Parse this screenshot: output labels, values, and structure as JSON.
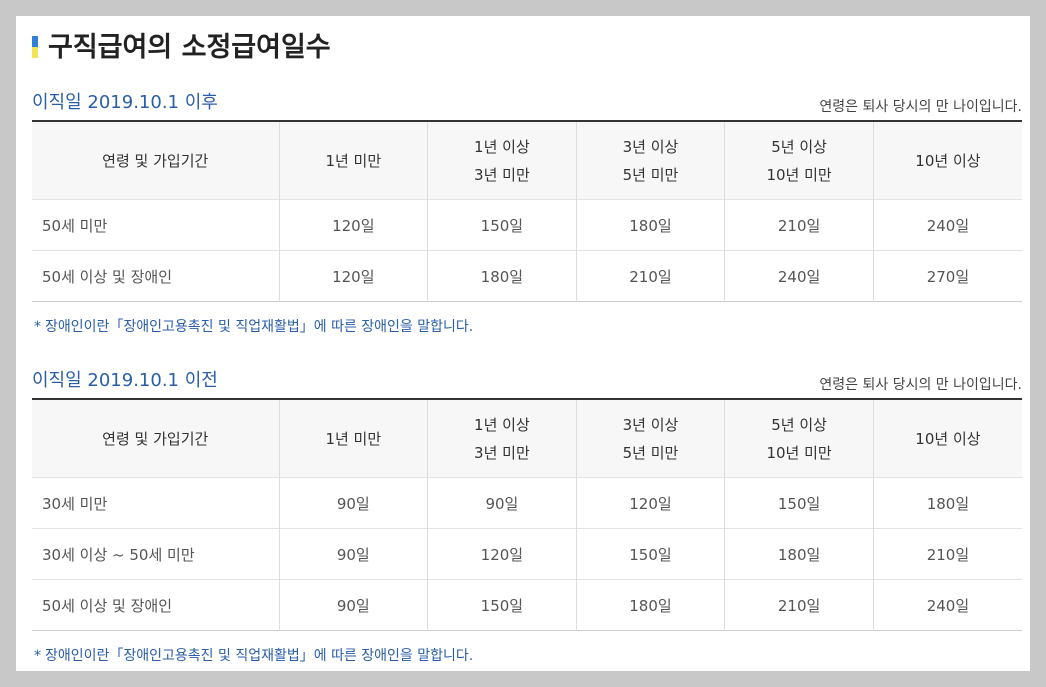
{
  "page_title": "구직급여의 소정급여일수",
  "sections": [
    {
      "title": "이직일 2019.10.1 이후",
      "note": "연령은 퇴사 당시의 만 나이입니다.",
      "headers": [
        "연령 및 가입기간",
        "1년 미만",
        "1년 이상",
        "3년 미만",
        "3년 이상",
        "5년 미만",
        "5년 이상",
        "10년 미만",
        "10년 이상"
      ],
      "rows": [
        [
          "50세 미만",
          "120일",
          "150일",
          "180일",
          "210일",
          "240일"
        ],
        [
          "50세 이상 및 장애인",
          "120일",
          "180일",
          "210일",
          "240일",
          "270일"
        ]
      ],
      "footnote": "장애인이란「장애인고용촉진 및 직업재활법」에 따른 장애인을 말합니다."
    },
    {
      "title": "이직일 2019.10.1 이전",
      "note": "연령은 퇴사 당시의 만 나이입니다.",
      "headers": [
        "연령 및 가입기간",
        "1년 미만",
        "1년 이상",
        "3년 미만",
        "3년 이상",
        "5년 미만",
        "5년 이상",
        "10년 미만",
        "10년 이상"
      ],
      "rows": [
        [
          "30세 미만",
          "90일",
          "90일",
          "120일",
          "150일",
          "180일"
        ],
        [
          "30세 이상 ~ 50세 미만",
          "90일",
          "120일",
          "150일",
          "180일",
          "210일"
        ],
        [
          "50세 이상 및 장애인",
          "90일",
          "150일",
          "180일",
          "210일",
          "240일"
        ]
      ],
      "footnote": "장애인이란「장애인고용촉진 및 직업재활법」에 따른 장애인을 말합니다."
    }
  ],
  "footnote_marker": "*",
  "colors": {
    "accent_blue": "#2a5ea8",
    "bar_blue": "#2f7fd6",
    "bar_yellow": "#f2e45a"
  }
}
